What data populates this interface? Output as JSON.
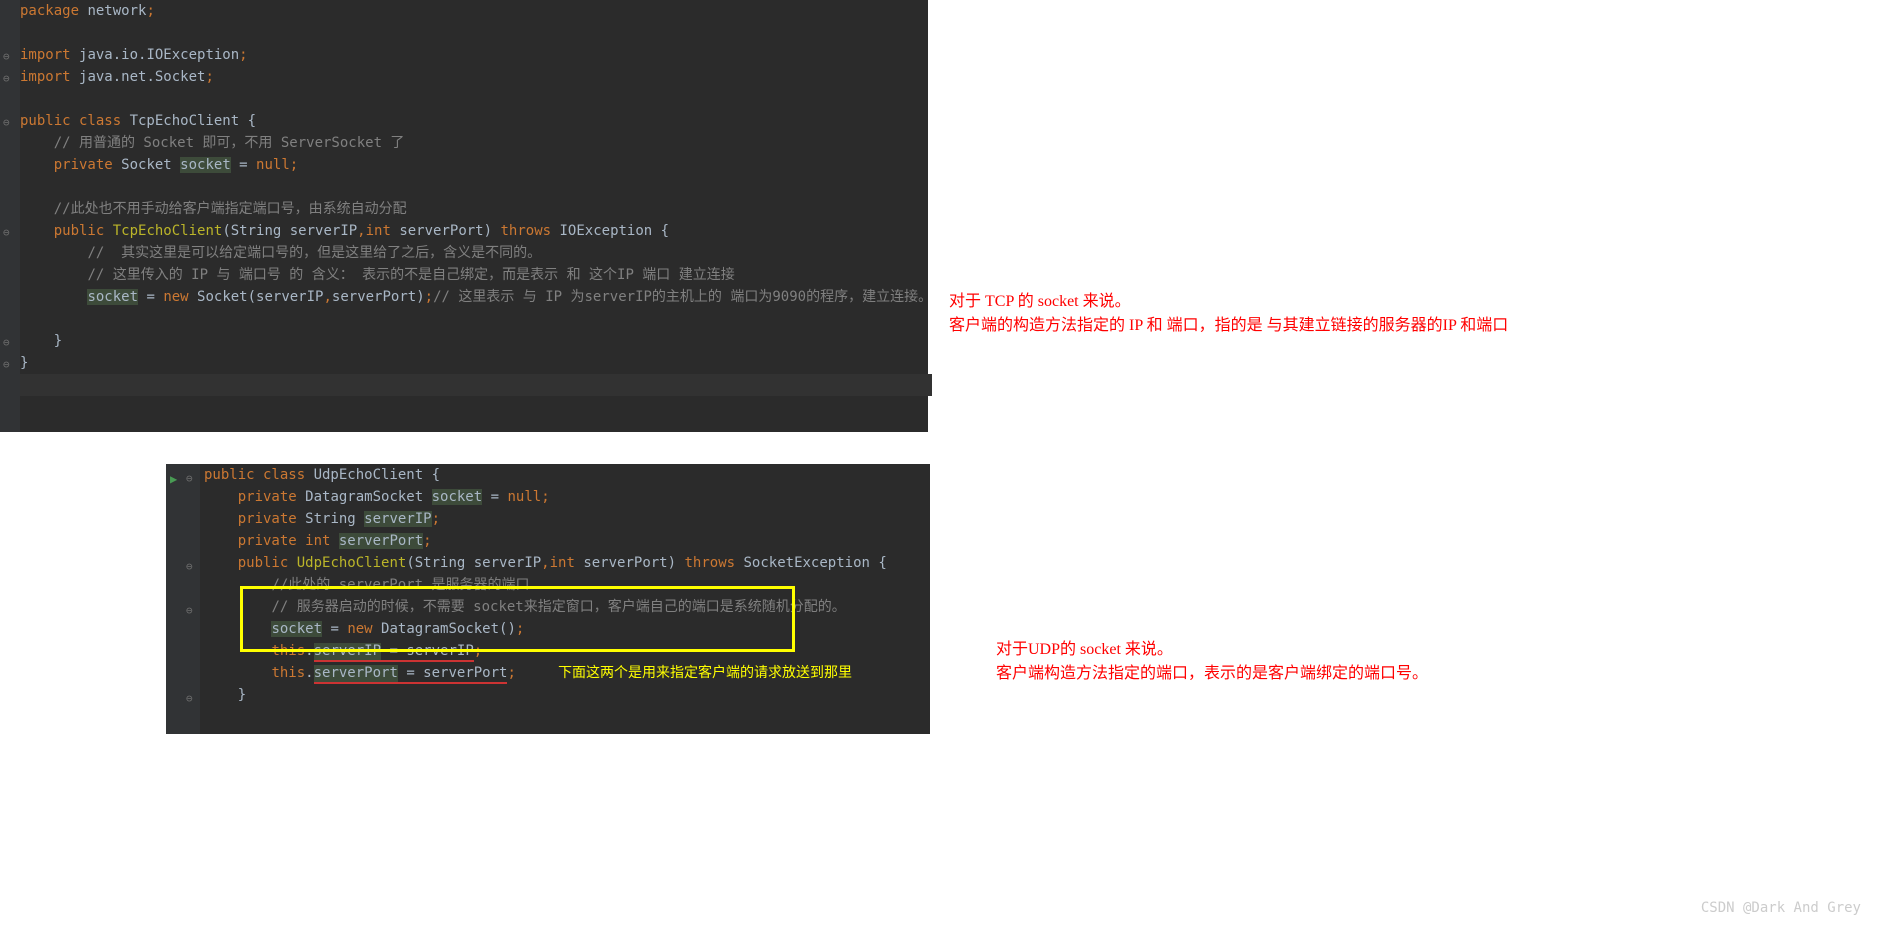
{
  "editor1": {
    "lines": [
      {
        "indent": "",
        "tokens": [
          {
            "t": "package ",
            "c": "kw"
          },
          {
            "t": "network",
            "c": ""
          },
          {
            "t": ";",
            "c": "kw"
          }
        ]
      },
      {
        "indent": "",
        "tokens": []
      },
      {
        "indent": "",
        "tokens": [
          {
            "t": "import ",
            "c": "kw"
          },
          {
            "t": "java.io.IOException",
            "c": ""
          },
          {
            "t": ";",
            "c": "kw"
          }
        ]
      },
      {
        "indent": "",
        "tokens": [
          {
            "t": "import ",
            "c": "kw"
          },
          {
            "t": "java.net.Socket",
            "c": ""
          },
          {
            "t": ";",
            "c": "kw"
          }
        ]
      },
      {
        "indent": "",
        "tokens": []
      },
      {
        "indent": "",
        "tokens": [
          {
            "t": "public class ",
            "c": "kw"
          },
          {
            "t": "TcpEchoClient ",
            "c": "cls"
          },
          {
            "t": "{",
            "c": ""
          }
        ]
      },
      {
        "indent": "    ",
        "tokens": [
          {
            "t": "// 用普通的 Socket 即可，不用 ServerSocket 了",
            "c": "comment"
          }
        ]
      },
      {
        "indent": "    ",
        "tokens": [
          {
            "t": "private ",
            "c": "kw"
          },
          {
            "t": "Socket ",
            "c": ""
          },
          {
            "t": "socket",
            "c": "highlight"
          },
          {
            "t": " = ",
            "c": ""
          },
          {
            "t": "null",
            "c": "kw"
          },
          {
            "t": ";",
            "c": "kw"
          }
        ]
      },
      {
        "indent": "",
        "tokens": []
      },
      {
        "indent": "    ",
        "tokens": [
          {
            "t": "//此处也不用手动给客户端指定端口号，由系统自动分配",
            "c": "comment"
          }
        ]
      },
      {
        "indent": "    ",
        "tokens": [
          {
            "t": "public ",
            "c": "kw"
          },
          {
            "t": "TcpEchoClient",
            "c": "ann"
          },
          {
            "t": "(String serverIP",
            "c": ""
          },
          {
            "t": ",",
            "c": "kw"
          },
          {
            "t": "int ",
            "c": "kw"
          },
          {
            "t": "serverPort) ",
            "c": ""
          },
          {
            "t": "throws ",
            "c": "kw"
          },
          {
            "t": "IOException {",
            "c": ""
          }
        ]
      },
      {
        "indent": "        ",
        "tokens": [
          {
            "t": "//  其实这里是可以给定端口号的，但是这里给了之后，含义是不同的。",
            "c": "comment"
          }
        ]
      },
      {
        "indent": "        ",
        "tokens": [
          {
            "t": "// 这里传入的 IP 与 端口号 的 含义： 表示的不是自己绑定，而是表示 和 这个IP 端口 建立连接",
            "c": "comment"
          }
        ]
      },
      {
        "indent": "        ",
        "tokens": [
          {
            "t": "socket",
            "c": "highlight"
          },
          {
            "t": " = ",
            "c": ""
          },
          {
            "t": "new ",
            "c": "kw"
          },
          {
            "t": "Socket(serverIP",
            "c": ""
          },
          {
            "t": ",",
            "c": "kw"
          },
          {
            "t": "serverPort)",
            "c": ""
          },
          {
            "t": ";",
            "c": "kw"
          },
          {
            "t": "// 这里表示 与 IP 为serverIP的主机上的 端口为9090的程序，建立连接。",
            "c": "comment"
          }
        ]
      },
      {
        "indent": "",
        "tokens": []
      },
      {
        "indent": "    ",
        "tokens": [
          {
            "t": "}",
            "c": ""
          }
        ]
      },
      {
        "indent": "",
        "tokens": [
          {
            "t": "}",
            "c": ""
          }
        ]
      },
      {
        "indent": "",
        "tokens": [],
        "caret": true
      }
    ]
  },
  "editor2": {
    "lines": [
      {
        "indent": "",
        "tokens": [
          {
            "t": "public class ",
            "c": "kw"
          },
          {
            "t": "UdpEchoClient ",
            "c": "cls"
          },
          {
            "t": "{",
            "c": ""
          }
        ]
      },
      {
        "indent": "    ",
        "tokens": [
          {
            "t": "private ",
            "c": "kw"
          },
          {
            "t": "DatagramSocket ",
            "c": ""
          },
          {
            "t": "socket",
            "c": "highlight"
          },
          {
            "t": " = ",
            "c": ""
          },
          {
            "t": "null",
            "c": "kw"
          },
          {
            "t": ";",
            "c": "kw"
          }
        ]
      },
      {
        "indent": "    ",
        "tokens": [
          {
            "t": "private ",
            "c": "kw"
          },
          {
            "t": "String ",
            "c": ""
          },
          {
            "t": "serverIP",
            "c": "highlight"
          },
          {
            "t": ";",
            "c": "kw"
          }
        ]
      },
      {
        "indent": "    ",
        "tokens": [
          {
            "t": "private int ",
            "c": "kw"
          },
          {
            "t": "serverPort",
            "c": "highlight"
          },
          {
            "t": ";",
            "c": "kw"
          }
        ]
      },
      {
        "indent": "    ",
        "tokens": [
          {
            "t": "public ",
            "c": "kw"
          },
          {
            "t": "UdpEchoClient",
            "c": "ann"
          },
          {
            "t": "(String serverIP",
            "c": ""
          },
          {
            "t": ",",
            "c": "kw"
          },
          {
            "t": "int ",
            "c": "kw"
          },
          {
            "t": "serverPort) ",
            "c": ""
          },
          {
            "t": "throws ",
            "c": "kw"
          },
          {
            "t": "SocketException {",
            "c": ""
          }
        ]
      },
      {
        "indent": "        ",
        "tokens": [
          {
            "t": "//此处的 serverPort 是服务器的端口",
            "c": "comment"
          }
        ]
      },
      {
        "indent": "        ",
        "tokens": [
          {
            "t": "// 服务器启动的时候，不需要 socket来指定窗口，客户端自己的端口是系统随机分配的。",
            "c": "comment"
          }
        ]
      },
      {
        "indent": "        ",
        "tokens": [
          {
            "t": "socket",
            "c": "highlight"
          },
          {
            "t": " = ",
            "c": ""
          },
          {
            "t": "new ",
            "c": "kw"
          },
          {
            "t": "DatagramSocket()",
            "c": ""
          },
          {
            "t": ";",
            "c": "kw"
          }
        ]
      },
      {
        "indent": "        ",
        "tokens": [
          {
            "t": "this",
            "c": "kw"
          },
          {
            "t": ".",
            "c": ""
          },
          {
            "t": "serverIP",
            "c": "highlight red-underline"
          },
          {
            "t": " = serverIP",
            "c": "red-underline"
          },
          {
            "t": ";",
            "c": "kw"
          }
        ]
      },
      {
        "indent": "        ",
        "tokens": [
          {
            "t": "this",
            "c": "kw"
          },
          {
            "t": ".",
            "c": ""
          },
          {
            "t": "serverPort",
            "c": "highlight red-underline"
          },
          {
            "t": " = serverPort",
            "c": "red-underline"
          },
          {
            "t": ";",
            "c": "kw"
          },
          {
            "t": "     ",
            "c": ""
          },
          {
            "t": "下面这两个是用来指定客户端的请求放送到那里",
            "c": "inline-anno"
          }
        ]
      },
      {
        "indent": "    ",
        "tokens": [
          {
            "t": "}",
            "c": ""
          }
        ]
      }
    ]
  },
  "annotation1": {
    "line1": "对于 TCP 的 socket 来说。",
    "line2": "客户端的构造方法指定的 IP 和 端口，指的是 与其建立链接的服务器的IP 和端口"
  },
  "annotation2": {
    "line1": "对于UDP的 socket 来说。",
    "line2": "客户端构造方法指定的端口，表示的是客户端绑定的端口号。"
  },
  "watermark": "CSDN @Dark And Grey"
}
